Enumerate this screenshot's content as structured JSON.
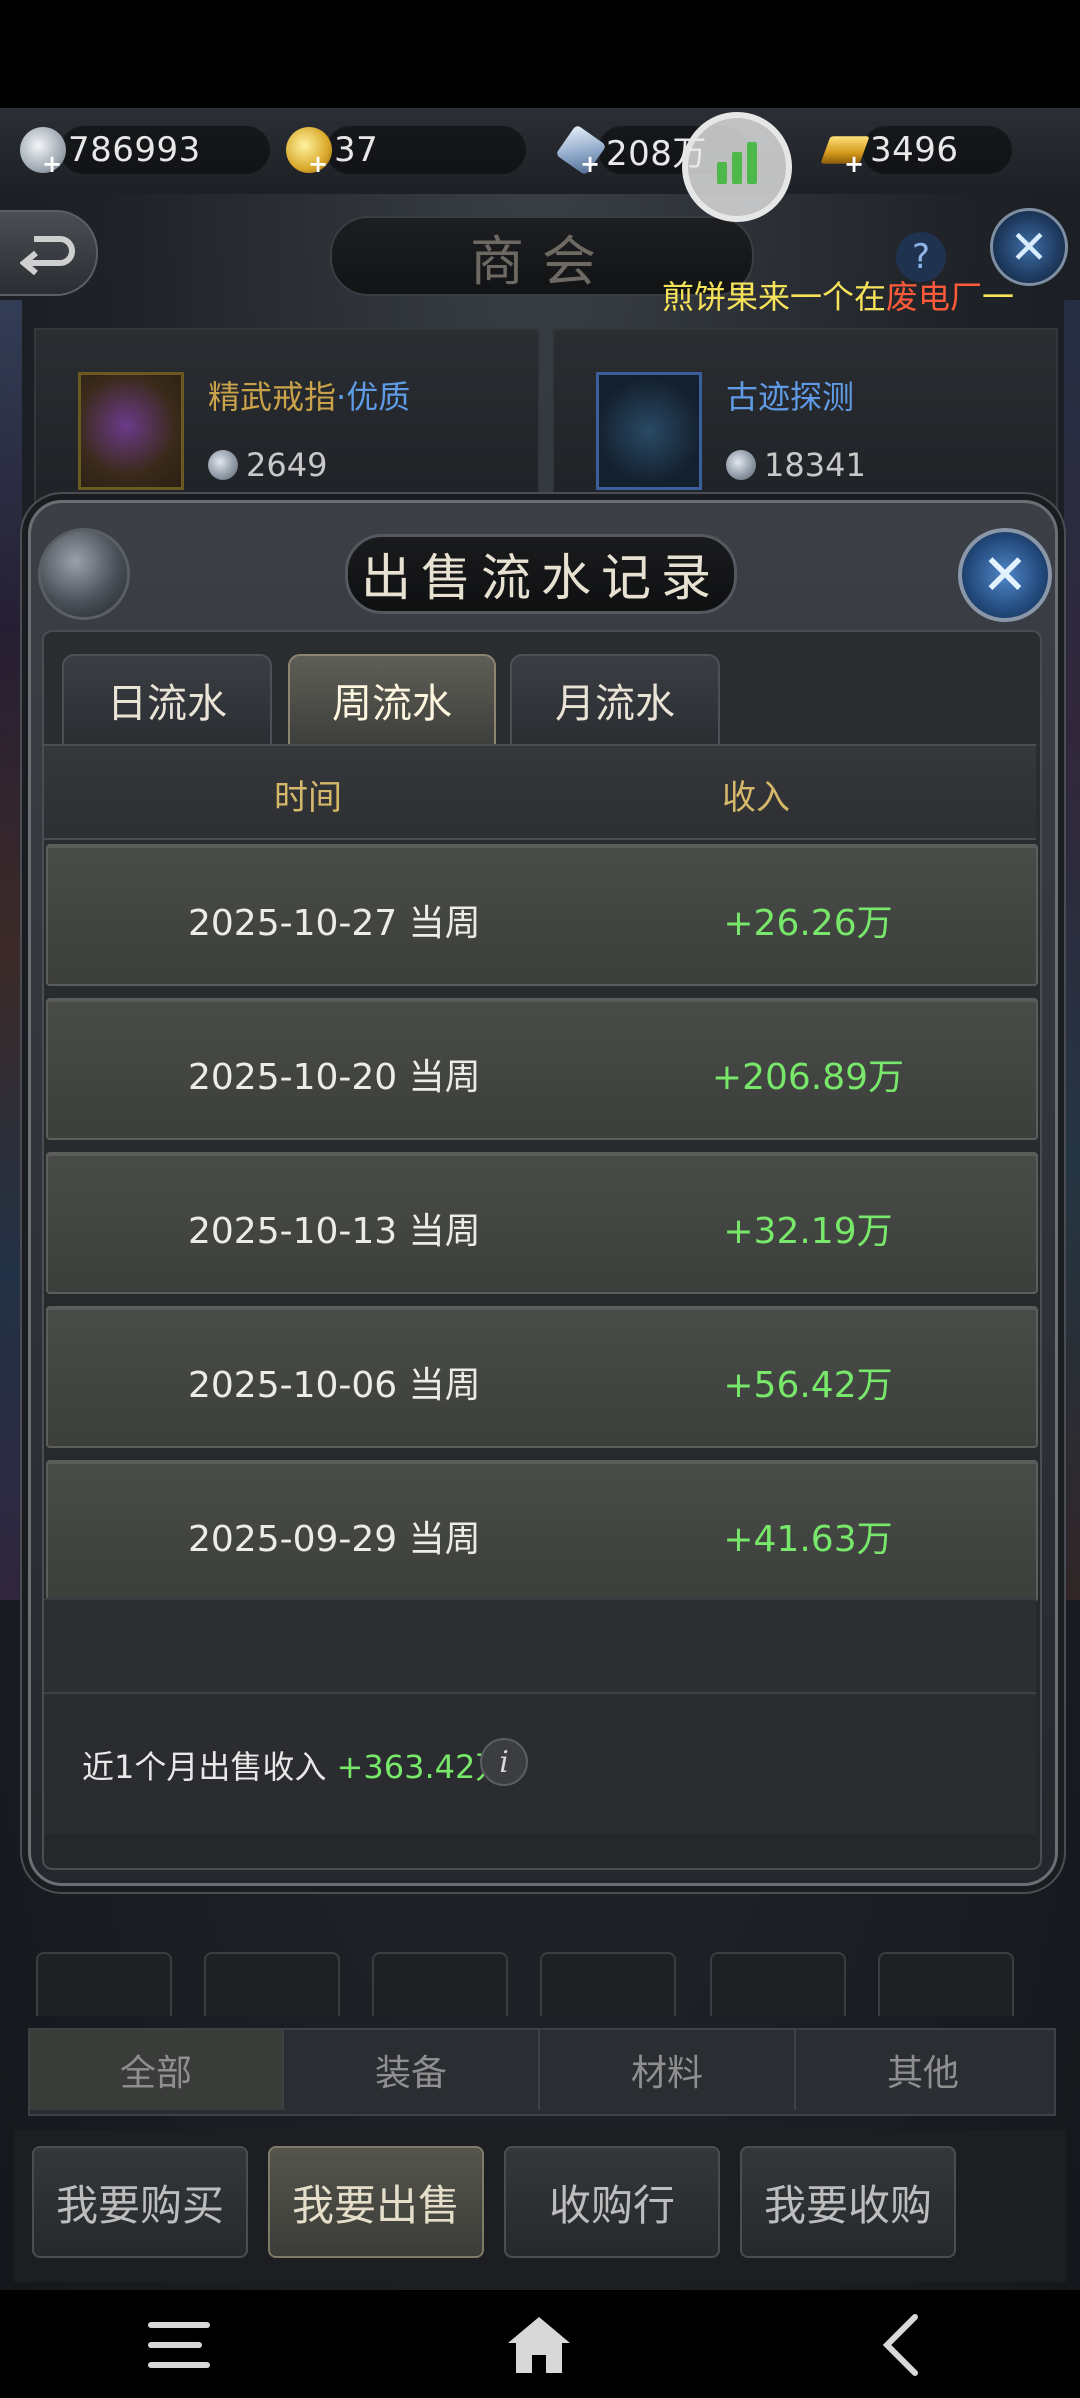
{
  "currencies": [
    {
      "icon": "silver-coin-icon",
      "value": "786993"
    },
    {
      "icon": "gold-coin-icon",
      "value": "37"
    },
    {
      "icon": "crystal-icon",
      "value": "208万"
    },
    {
      "icon": "gold-bar-icon",
      "value": "3496"
    }
  ],
  "header": {
    "title": "商会",
    "marquee_part1": "煎饼果来一个在",
    "marquee_part2": "废电厂",
    "marquee_part3": "一"
  },
  "cards": [
    {
      "name": "精武戒指",
      "quality": "·优质",
      "price": "2649"
    },
    {
      "name": "古迹探测",
      "quality": "",
      "price": "18341"
    }
  ],
  "modal": {
    "title": "出售流水记录",
    "tabs": [
      {
        "label": "日流水",
        "active": false
      },
      {
        "label": "周流水",
        "active": true
      },
      {
        "label": "月流水",
        "active": false
      }
    ],
    "columns": {
      "time": "时间",
      "income": "收入"
    },
    "rows": [
      {
        "date": "2025-10-27 当周",
        "amount": "+26.26万"
      },
      {
        "date": "2025-10-20 当周",
        "amount": "+206.89万"
      },
      {
        "date": "2025-10-13 当周",
        "amount": "+32.19万"
      },
      {
        "date": "2025-10-06 当周",
        "amount": "+56.42万"
      },
      {
        "date": "2025-09-29 当周",
        "amount": "+41.63万"
      }
    ],
    "summary_label": "近1个月出售收入",
    "summary_value": "+363.42万",
    "info_glyph": "i"
  },
  "categories": [
    "全部",
    "装备",
    "材料",
    "其他"
  ],
  "actions": [
    "我要购买",
    "我要出售",
    "收购行",
    "我要收购"
  ],
  "colors": {
    "income_green": "#78e86a",
    "header_gold": "#d6b86a",
    "marquee_yellow": "#f6e35a"
  }
}
